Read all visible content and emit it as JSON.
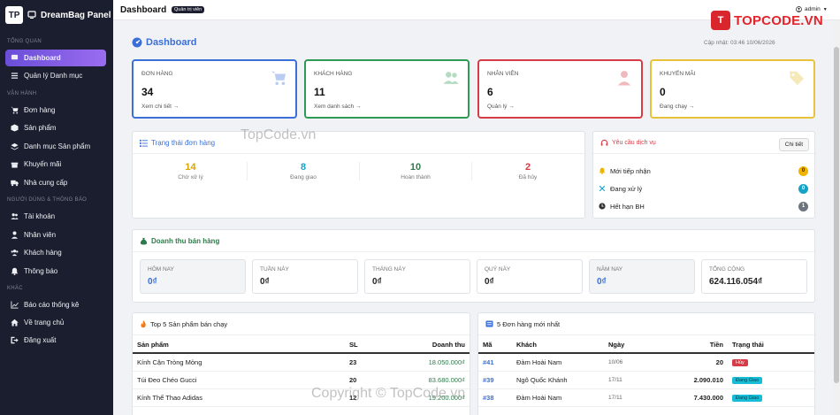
{
  "brand": {
    "name": "DreamBag Panel",
    "logo_text": "TP"
  },
  "sidebar": {
    "sections": [
      {
        "title": "TỔNG QUAN",
        "items": [
          {
            "label": "Dashboard",
            "icon": "dashboard-icon",
            "active": true
          },
          {
            "label": "Quản lý Danh mục",
            "icon": "list-icon"
          }
        ]
      },
      {
        "title": "VẬN HÀNH",
        "items": [
          {
            "label": "Đơn hàng",
            "icon": "cart-icon"
          },
          {
            "label": "Sản phẩm",
            "icon": "box-icon"
          },
          {
            "label": "Danh mục Sản phẩm",
            "icon": "layers-icon"
          },
          {
            "label": "Khuyến mãi",
            "icon": "gift-icon"
          },
          {
            "label": "Nhà cung cấp",
            "icon": "truck-icon"
          }
        ]
      },
      {
        "title": "NGƯỜI DÙNG & THÔNG BÁO",
        "items": [
          {
            "label": "Tài khoản",
            "icon": "users-icon"
          },
          {
            "label": "Nhân viên",
            "icon": "user-tie-icon"
          },
          {
            "label": "Khách hàng",
            "icon": "user-group-icon"
          },
          {
            "label": "Thông báo",
            "icon": "bell-icon"
          }
        ]
      },
      {
        "title": "KHÁC",
        "items": [
          {
            "label": "Báo cáo thống kê",
            "icon": "chart-icon"
          },
          {
            "label": "Về trang chủ",
            "icon": "home-icon"
          },
          {
            "label": "Đăng xuất",
            "icon": "logout-icon"
          }
        ]
      }
    ]
  },
  "topbar": {
    "title": "Dashboard",
    "role_badge": "Quản trị viên",
    "user": "admin",
    "logo_text": "TOPCODE.VN",
    "logo_mark": "T"
  },
  "page": {
    "title": "Dashboard",
    "updated": "Cập nhật: 03:46 10/06/2026"
  },
  "stats": [
    {
      "label": "ĐƠN HÀNG",
      "value": "34",
      "link": "Xem chi tiết →",
      "color": "#3a6fd8",
      "icon": "cart-icon"
    },
    {
      "label": "KHÁCH HÀNG",
      "value": "11",
      "link": "Xem danh sách →",
      "color": "#2e9a55",
      "icon": "users-icon"
    },
    {
      "label": "NHÂN VIÊN",
      "value": "6",
      "link": "Quản lý →",
      "color": "#d73b46",
      "icon": "user-tie-icon"
    },
    {
      "label": "KHUYẾN MÃI",
      "value": "0",
      "link": "Đang chạy →",
      "color": "#e8c23a",
      "icon": "tags-icon"
    }
  ],
  "order_status": {
    "title": "Trạng thái đơn hàng",
    "items": [
      {
        "value": "14",
        "label": "Chờ xử lý",
        "color": "#d9a400"
      },
      {
        "value": "8",
        "label": "Đang giao",
        "color": "#17a2c8"
      },
      {
        "value": "10",
        "label": "Hoàn thành",
        "color": "#2e7a4a"
      },
      {
        "value": "2",
        "label": "Đã hủy",
        "color": "#d73b46"
      }
    ]
  },
  "service": {
    "title": "Yêu cầu dịch vụ",
    "detail_btn": "Chi tiết",
    "items": [
      {
        "label": "Mới tiếp nhận",
        "count": "0",
        "color": "#f0b400",
        "icon": "bell-icon"
      },
      {
        "label": "Đang xử lý",
        "count": "0",
        "color": "#17a2c8",
        "icon": "tools-icon"
      },
      {
        "label": "Hết hạn BH",
        "count": "1",
        "color": "#6c757d",
        "icon": "clock-icon"
      }
    ]
  },
  "revenue": {
    "title": "Doanh thu bán hàng",
    "items": [
      {
        "label": "HÔM NAY",
        "value": "0₫",
        "color": "#3a6fd8",
        "shaded": true
      },
      {
        "label": "TUẦN NÀY",
        "value": "0₫",
        "color": "#222"
      },
      {
        "label": "THÁNG NÀY",
        "value": "0₫",
        "color": "#222"
      },
      {
        "label": "QUÝ NÀY",
        "value": "0₫",
        "color": "#222"
      },
      {
        "label": "NĂM NAY",
        "value": "0₫",
        "color": "#3a6fd8",
        "shaded": true
      },
      {
        "label": "TỔNG CỘNG",
        "value": "624.116.054₫",
        "color": "#222"
      }
    ]
  },
  "top_products": {
    "title": "Top 5 Sản phẩm bán chạy",
    "headers": [
      "Sản phẩm",
      "SL",
      "Doanh thu"
    ],
    "rows": [
      [
        "Kính Cận Tròng Mỏng",
        "23",
        "18.050.000₫"
      ],
      [
        "Túi Đeo Chéo Gucci",
        "20",
        "83.680.000₫"
      ],
      [
        "Kính Thể Thao Adidas",
        "12",
        "19.200.000₫"
      ]
    ]
  },
  "latest_orders": {
    "title": "5 Đơn hàng mới nhất",
    "headers": [
      "Mã",
      "Khách",
      "Ngày",
      "Tiền",
      "Trạng thái"
    ],
    "rows": [
      {
        "id": "#41",
        "customer": "Đàm Hoài Nam",
        "date": "10/06",
        "amount": "20",
        "status": "Hủy",
        "status_color": "#d73b46"
      },
      {
        "id": "#39",
        "customer": "Ngô Quốc Khánh",
        "date": "17/11",
        "amount": "2.090.010",
        "status": "Đang Giao",
        "status_color": "#17bcd6"
      },
      {
        "id": "#38",
        "customer": "Đàm Hoài Nam",
        "date": "17/11",
        "amount": "7.430.000",
        "status": "Đang Giao",
        "status_color": "#17bcd6"
      }
    ]
  },
  "watermarks": [
    "TopCode.vn",
    "Copyright © TopCode.vn"
  ]
}
